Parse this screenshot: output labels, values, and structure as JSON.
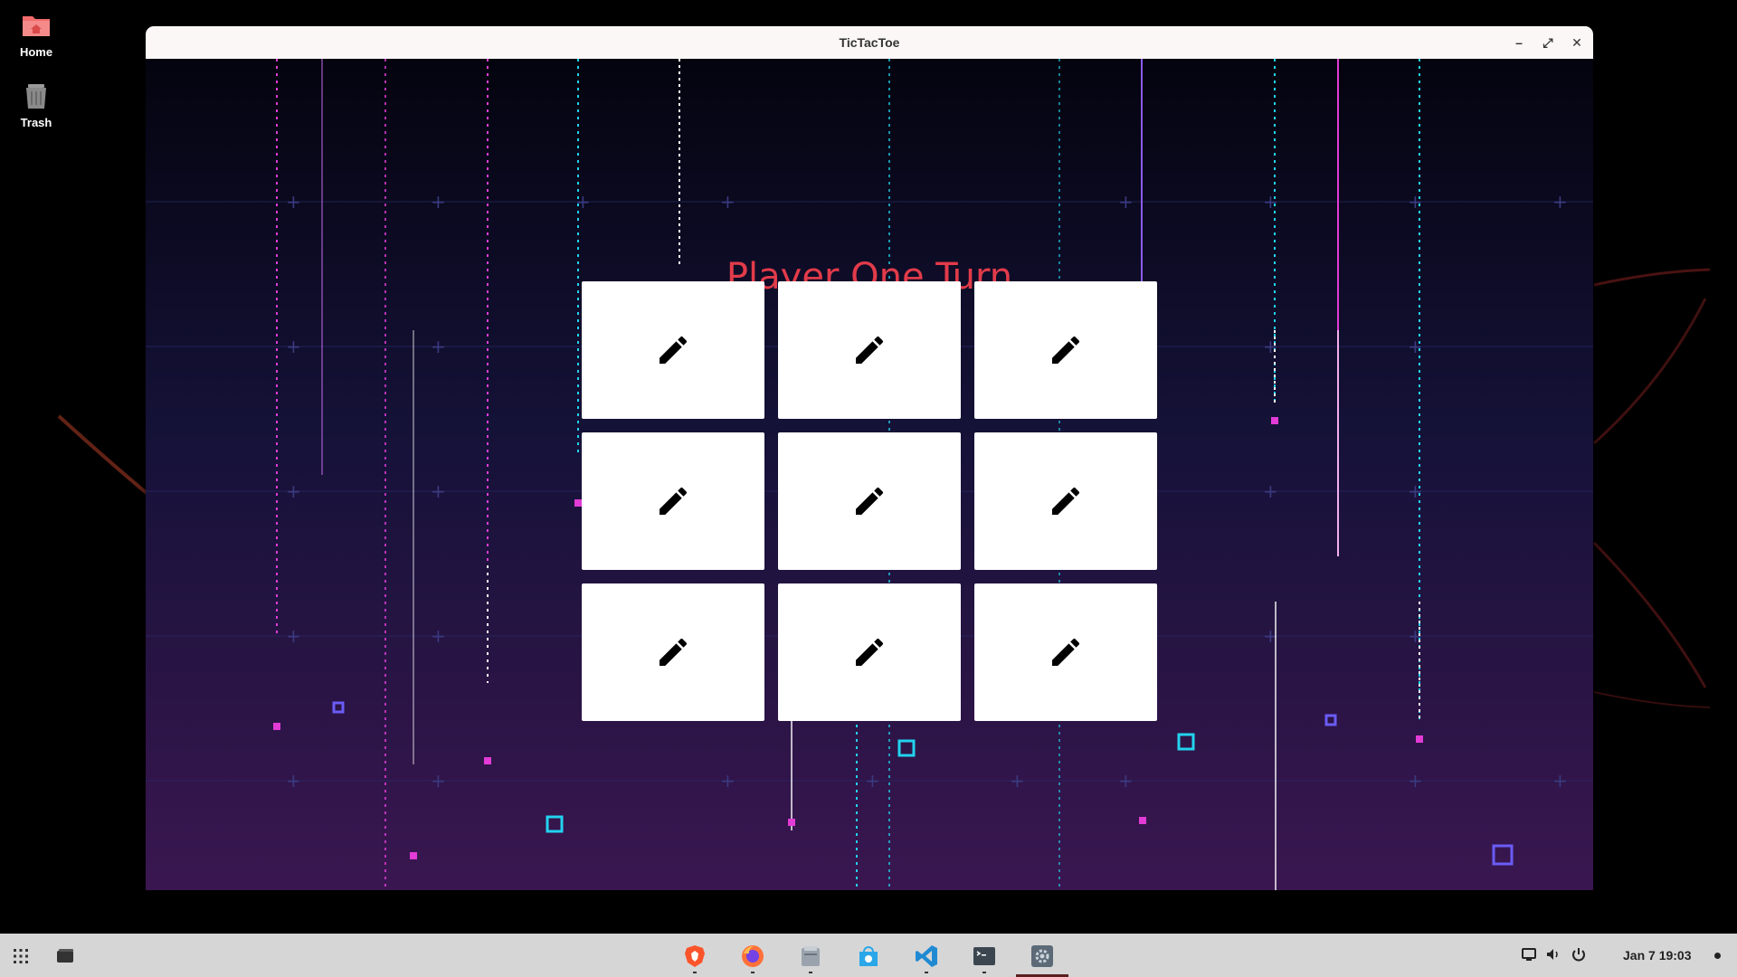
{
  "desktop": {
    "icons": [
      {
        "label": "Home",
        "icon": "home-folder-icon",
        "color": "#f26b6b"
      },
      {
        "label": "Trash",
        "icon": "trash-icon",
        "color": "#8a8a8a"
      }
    ]
  },
  "window": {
    "title": "TicTacToe",
    "controls": {
      "minimize": "–",
      "maximize": "⤢",
      "close": "✕"
    }
  },
  "game": {
    "turn_text": "Player One Turn",
    "turn_color": "#e23b4a",
    "cells": [
      {
        "icon": "pencil-icon"
      },
      {
        "icon": "pencil-icon"
      },
      {
        "icon": "pencil-icon"
      },
      {
        "icon": "pencil-icon"
      },
      {
        "icon": "pencil-icon"
      },
      {
        "icon": "pencil-icon"
      },
      {
        "icon": "pencil-icon"
      },
      {
        "icon": "pencil-icon"
      },
      {
        "icon": "pencil-icon"
      }
    ]
  },
  "taskbar": {
    "apps": [
      "app-grid-icon",
      "window-switcher-icon"
    ],
    "pinned": [
      {
        "name": "brave-browser-icon",
        "running": true
      },
      {
        "name": "firefox-icon",
        "running": true
      },
      {
        "name": "files-icon",
        "running": true
      },
      {
        "name": "software-store-icon",
        "running": false
      },
      {
        "name": "vscode-icon",
        "running": true
      },
      {
        "name": "terminal-icon",
        "running": true
      },
      {
        "name": "settings-icon",
        "running": true,
        "active": true
      }
    ],
    "tray": [
      "display-icon",
      "volume-icon",
      "power-icon"
    ],
    "clock": "Jan 7  19:03"
  },
  "theme": {
    "background": "#07071a",
    "accent_pink": "#e23bd6",
    "accent_cyan": "#22d3ee",
    "accent_purple": "#8b5cf6"
  }
}
